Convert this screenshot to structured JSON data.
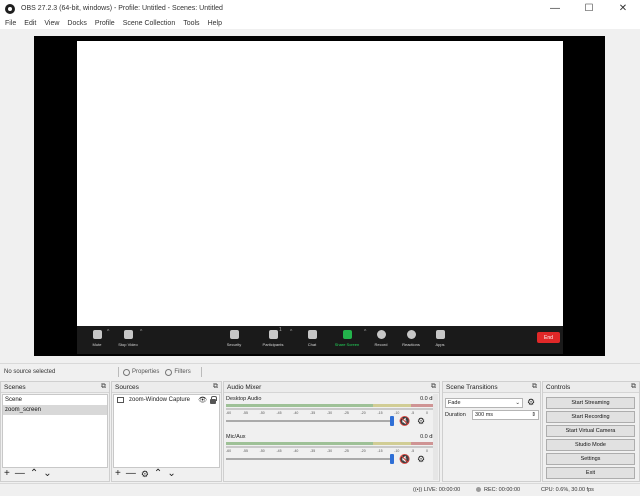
{
  "window": {
    "title": "OBS 27.2.3 (64-bit, windows) - Profile: Untitled - Scenes: Untitled",
    "minimize_icon": "minimize-icon",
    "maximize_icon": "maximize-icon",
    "close_icon": "close-icon"
  },
  "menu": [
    "File",
    "Edit",
    "View",
    "Docks",
    "Profile",
    "Scene Collection",
    "Tools",
    "Help"
  ],
  "zoom_toolbar": {
    "items": [
      "Mute",
      "Stop Video",
      "Security",
      "Participants",
      "Chat",
      "Share Screen",
      "Record",
      "Reactions",
      "Apps"
    ],
    "participants_count": "1",
    "end_label": "End"
  },
  "source_bar": {
    "no_source": "No source selected",
    "properties": "Properties",
    "filters": "Filters"
  },
  "scenes": {
    "title": "Scenes",
    "items": [
      "Scene",
      "zoom_screen"
    ],
    "selected_index": 1
  },
  "sources": {
    "title": "Sources",
    "items": [
      "zoom-Window Capture"
    ]
  },
  "audio_mixer": {
    "title": "Audio Mixer",
    "channels": [
      {
        "name": "Desktop Audio",
        "db": "0.0 dB"
      },
      {
        "name": "Mic/Aux",
        "db": "0.0 dB"
      }
    ],
    "scale": [
      "-60",
      "-55",
      "-50",
      "-45",
      "-40",
      "-35",
      "-30",
      "-25",
      "-20",
      "-15",
      "-10",
      "-5",
      "0"
    ]
  },
  "transitions": {
    "title": "Scene Transitions",
    "selected": "Fade",
    "duration_label": "Duration",
    "duration_value": "300 ms"
  },
  "controls": {
    "title": "Controls",
    "buttons": [
      "Start Streaming",
      "Start Recording",
      "Start Virtual Camera",
      "Studio Mode",
      "Settings",
      "Exit"
    ]
  },
  "status": {
    "live": "LIVE: 00:00:00",
    "rec": "REC: 00:00:00",
    "cpu": "CPU: 0.6%, 30.00 fps"
  }
}
